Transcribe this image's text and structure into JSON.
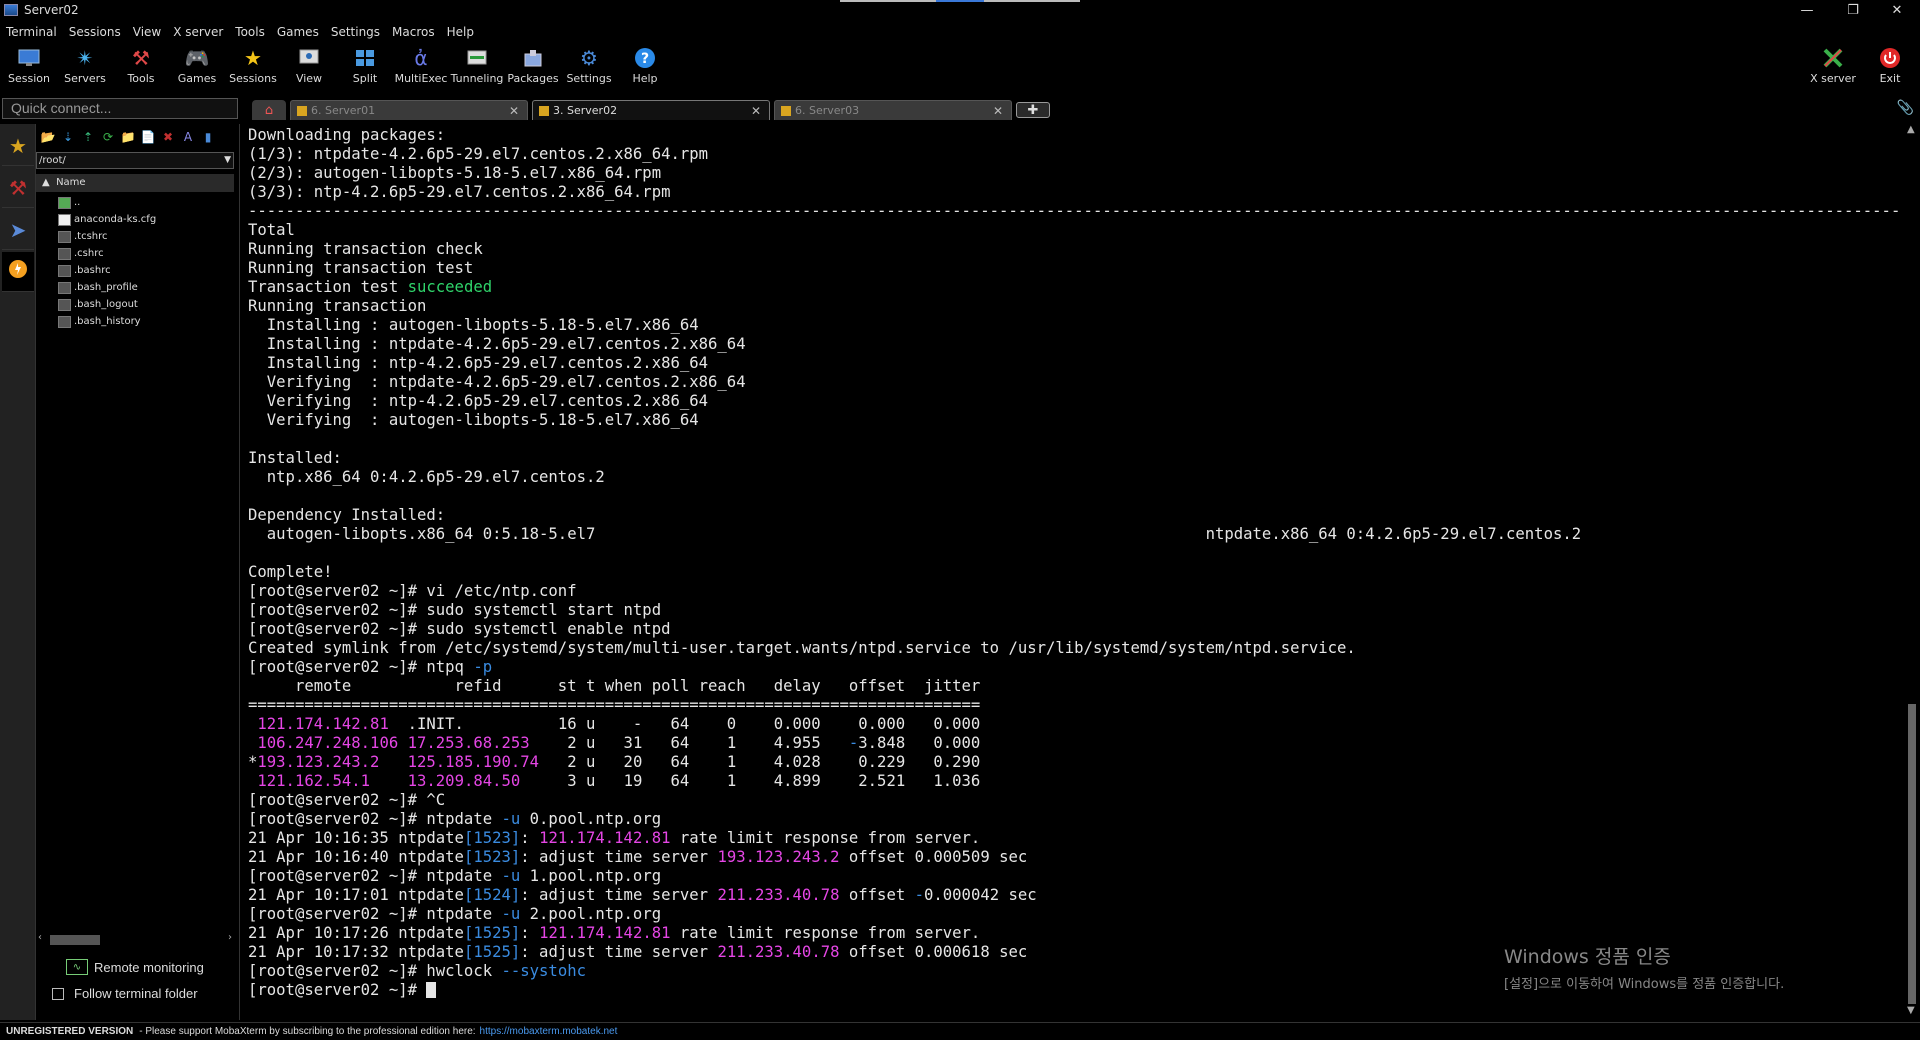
{
  "window": {
    "title": "Server02"
  },
  "menu": [
    "Terminal",
    "Sessions",
    "View",
    "X server",
    "Tools",
    "Games",
    "Settings",
    "Macros",
    "Help"
  ],
  "toolbar": {
    "session": "Session",
    "servers": "Servers",
    "tools": "Tools",
    "games": "Games",
    "sessions": "Sessions",
    "view": "View",
    "split": "Split",
    "multiexec": "MultiExec",
    "tunneling": "Tunneling",
    "packages": "Packages",
    "settings": "Settings",
    "help": "Help",
    "xserver": "X server",
    "exit": "Exit"
  },
  "quick_connect": {
    "placeholder": "Quick connect..."
  },
  "tabs": [
    {
      "label": "6. Server01"
    },
    {
      "label": "3. Server02"
    },
    {
      "label": "6. Server03"
    }
  ],
  "filebrowser": {
    "path": "/root/",
    "column": "Name",
    "files": [
      "..",
      "anaconda-ks.cfg",
      ".tcshrc",
      ".cshrc",
      ".bashrc",
      ".bash_profile",
      ".bash_logout",
      ".bash_history"
    ],
    "remote_monitoring": "Remote monitoring",
    "follow_folder": "Follow terminal folder"
  },
  "terminal": {
    "lines": [
      [
        {
          "t": "Downloading packages:"
        }
      ],
      [
        {
          "t": "(1/3): ntpdate-4.2.6p5-29.el7.centos.2.x86_64.rpm"
        }
      ],
      [
        {
          "t": "(2/3): autogen-libopts-5.18-5.el7.x86_64.rpm"
        }
      ],
      [
        {
          "t": "(3/3): ntp-4.2.6p5-29.el7.centos.2.x86_64.rpm"
        }
      ],
      [
        {
          "t": "--------------------------------------------------------------------------------------------------------------------------------------------------------------------------------"
        }
      ],
      [
        {
          "t": "Total"
        }
      ],
      [
        {
          "t": "Running transaction check"
        }
      ],
      [
        {
          "t": "Running transaction test"
        }
      ],
      [
        {
          "t": "Transaction test "
        },
        {
          "t": "succeeded",
          "c": "green"
        }
      ],
      [
        {
          "t": "Running transaction"
        }
      ],
      [
        {
          "t": "  Installing : autogen-libopts-5.18-5.el7.x86_64"
        }
      ],
      [
        {
          "t": "  Installing : ntpdate-4.2.6p5-29.el7.centos.2.x86_64"
        }
      ],
      [
        {
          "t": "  Installing : ntp-4.2.6p5-29.el7.centos.2.x86_64"
        }
      ],
      [
        {
          "t": "  Verifying  : ntpdate-4.2.6p5-29.el7.centos.2.x86_64"
        }
      ],
      [
        {
          "t": "  Verifying  : ntp-4.2.6p5-29.el7.centos.2.x86_64"
        }
      ],
      [
        {
          "t": "  Verifying  : autogen-libopts-5.18-5.el7.x86_64"
        }
      ],
      [
        {
          "t": ""
        }
      ],
      [
        {
          "t": "Installed:"
        }
      ],
      [
        {
          "t": "  ntp.x86_64 0:4.2.6p5-29.el7.centos.2"
        }
      ],
      [
        {
          "t": ""
        }
      ],
      [
        {
          "t": "Dependency Installed:"
        }
      ],
      [
        {
          "t": "  autogen-libopts.x86_64 0:5.18-5.el7                                                                 ntpdate.x86_64 0:4.2.6p5-29.el7.centos.2"
        }
      ],
      [
        {
          "t": ""
        }
      ],
      [
        {
          "t": "Complete!"
        }
      ],
      [
        {
          "t": "[root@server02 ~]# vi /etc/ntp.conf"
        }
      ],
      [
        {
          "t": "[root@server02 ~]# sudo systemctl start ntpd"
        }
      ],
      [
        {
          "t": "[root@server02 ~]# sudo systemctl enable ntpd"
        }
      ],
      [
        {
          "t": "Created symlink from /etc/systemd/system/multi-user.target.wants/ntpd.service to /usr/lib/systemd/system/ntpd.service."
        }
      ],
      [
        {
          "t": "[root@server02 ~]# ntpq "
        },
        {
          "t": "-p",
          "c": "blue"
        }
      ],
      [
        {
          "t": "     remote           refid      st t when poll reach   delay   offset  jitter"
        }
      ],
      [
        {
          "t": "=============================================================================="
        }
      ],
      [
        {
          "t": " "
        },
        {
          "t": "121.174.142.81",
          "c": "mag"
        },
        {
          "t": "  .INIT.          16 u    -   64    0    0.000    0.000   0.000"
        }
      ],
      [
        {
          "t": " "
        },
        {
          "t": "106.247.248.106",
          "c": "mag"
        },
        {
          "t": " "
        },
        {
          "t": "17.253.68.253",
          "c": "mag"
        },
        {
          "t": "    2 u   31   64    1    4.955   "
        },
        {
          "t": "-",
          "c": "blue"
        },
        {
          "t": "3.848   0.000"
        }
      ],
      [
        {
          "t": "*"
        },
        {
          "t": "193.123.243.2",
          "c": "mag"
        },
        {
          "t": "   "
        },
        {
          "t": "125.185.190.74",
          "c": "mag"
        },
        {
          "t": "   2 u   20   64    1    4.028    0.229   0.290"
        }
      ],
      [
        {
          "t": " "
        },
        {
          "t": "121.162.54.1",
          "c": "mag"
        },
        {
          "t": "    "
        },
        {
          "t": "13.209.84.50",
          "c": "mag"
        },
        {
          "t": "     3 u   19   64    1    4.899    2.521   1.036"
        }
      ],
      [
        {
          "t": "[root@server02 ~]# ^C"
        }
      ],
      [
        {
          "t": "[root@server02 ~]# ntpdate "
        },
        {
          "t": "-u",
          "c": "blue"
        },
        {
          "t": " 0.pool.ntp.org"
        }
      ],
      [
        {
          "t": "21 Apr 10:16:35 ntpdate"
        },
        {
          "t": "[1523]",
          "c": "blue"
        },
        {
          "t": ": "
        },
        {
          "t": "121.174.142.81",
          "c": "mag"
        },
        {
          "t": " rate limit response from server."
        }
      ],
      [
        {
          "t": "21 Apr 10:16:40 ntpdate"
        },
        {
          "t": "[1523]",
          "c": "blue"
        },
        {
          "t": ": adjust time server "
        },
        {
          "t": "193.123.243.2",
          "c": "mag"
        },
        {
          "t": " offset 0.000509 sec"
        }
      ],
      [
        {
          "t": "[root@server02 ~]# ntpdate "
        },
        {
          "t": "-u",
          "c": "blue"
        },
        {
          "t": " 1.pool.ntp.org"
        }
      ],
      [
        {
          "t": "21 Apr 10:17:01 ntpdate"
        },
        {
          "t": "[1524]",
          "c": "blue"
        },
        {
          "t": ": adjust time server "
        },
        {
          "t": "211.233.40.78",
          "c": "mag"
        },
        {
          "t": " offset "
        },
        {
          "t": "-",
          "c": "blue"
        },
        {
          "t": "0.000042 sec"
        }
      ],
      [
        {
          "t": "[root@server02 ~]# ntpdate "
        },
        {
          "t": "-u",
          "c": "blue"
        },
        {
          "t": " 2.pool.ntp.org"
        }
      ],
      [
        {
          "t": "21 Apr 10:17:26 ntpdate"
        },
        {
          "t": "[1525]",
          "c": "blue"
        },
        {
          "t": ": "
        },
        {
          "t": "121.174.142.81",
          "c": "mag"
        },
        {
          "t": " rate limit response from server."
        }
      ],
      [
        {
          "t": "21 Apr 10:17:32 ntpdate"
        },
        {
          "t": "[1525]",
          "c": "blue"
        },
        {
          "t": ": adjust time server "
        },
        {
          "t": "211.233.40.78",
          "c": "mag"
        },
        {
          "t": " offset 0.000618 sec"
        }
      ],
      [
        {
          "t": "[root@server02 ~]# hwclock "
        },
        {
          "t": "--systohc",
          "c": "blue"
        }
      ],
      [
        {
          "t": "[root@server02 ~]# "
        },
        {
          "cursor": true
        }
      ]
    ]
  },
  "watermark": {
    "line1": "Windows 정품 인증",
    "line2": "[설정]으로 이동하여 Windows를 정품 인증합니다."
  },
  "statusbar": {
    "unregistered": "UNREGISTERED VERSION",
    "message": " -  Please support MobaXterm by subscribing to the professional edition here:",
    "link": "https://mobaxterm.mobatek.net"
  },
  "colors": {
    "green": "#2fd36a",
    "magenta": "#e546e5",
    "blue": "#3a8be0"
  }
}
